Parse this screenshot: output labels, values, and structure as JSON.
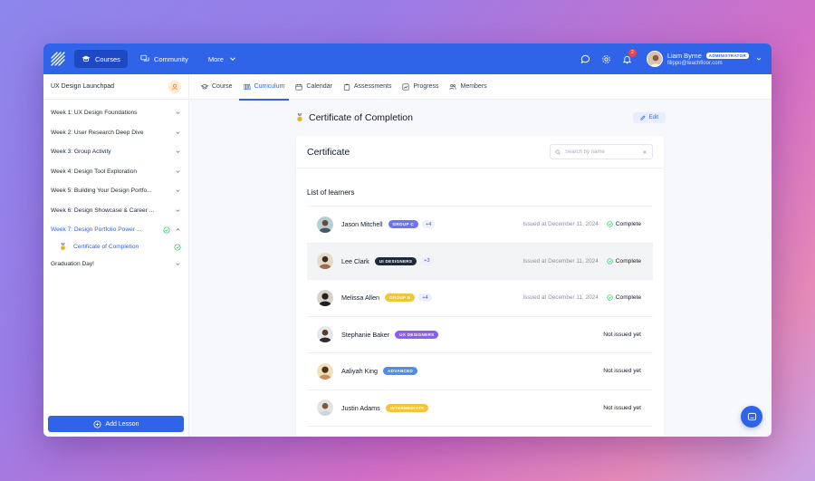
{
  "topbar": {
    "logo_icon": "stripes-logo",
    "nav": [
      {
        "label": "Courses",
        "icon": "graduation-cap-icon"
      },
      {
        "label": "Community",
        "icon": "chat-icon"
      },
      {
        "label": "More",
        "icon": "chevron-down-icon"
      }
    ],
    "notification_count": "2",
    "user": {
      "name": "Liam Byrne",
      "role": "ADMINISTRATOR",
      "email": "filippo@teachfloor.com"
    }
  },
  "sidebar": {
    "course_title": "UX Design Launchpad",
    "weeks": [
      {
        "label": "Week 1: UX Design Foundations"
      },
      {
        "label": "Week 2: User Research Deep Dive"
      },
      {
        "label": "Week 3: Group Activity"
      },
      {
        "label": "Week 4: Design Tool Exploration"
      },
      {
        "label": "Week 5: Building Your Design Portfo..."
      },
      {
        "label": "Week 6: Design Showcase & Career ..."
      },
      {
        "label": "Week 7: Design Portfolio Power ..."
      },
      {
        "label": "Graduation Day!"
      }
    ],
    "sub_item": "Certificate of Completion",
    "add_lesson": "Add Lesson"
  },
  "tabs": [
    "Course",
    "Curriculum",
    "Calendar",
    "Assessments",
    "Progress",
    "Members"
  ],
  "main": {
    "lesson_title": "Certificate of Completion",
    "edit_label": "Edit",
    "card_title": "Certificate",
    "search_placeholder": "Search by name",
    "list_label": "List of learners",
    "learners": [
      {
        "name": "Jason Mitchell",
        "tag": "GROUP C",
        "tag_color": "#6d74f0",
        "more": "+4",
        "issued": "Issued at December 11, 2024",
        "status": "Complete"
      },
      {
        "name": "Lee Clark",
        "tag": "UI DESIGNERS",
        "tag_color": "#1f2937",
        "more": "+3",
        "issued": "Issued at December 11, 2024",
        "status": "Complete"
      },
      {
        "name": "Melissa Allen",
        "tag": "GROUP B",
        "tag_color": "#f2c53d",
        "more": "+4",
        "issued": "Issued at December 11, 2024",
        "status": "Complete"
      },
      {
        "name": "Stephanie Baker",
        "tag": "UX DESIGNERS",
        "tag_color": "#8b5cf6",
        "more": "",
        "issued": "",
        "status": "Not issued yet"
      },
      {
        "name": "Aaliyah King",
        "tag": "ADVANCED",
        "tag_color": "#4f8de8",
        "more": "",
        "issued": "",
        "status": "Not issued yet"
      },
      {
        "name": "Justin Adams",
        "tag": "INTERMEDIATE",
        "tag_color": "#f2c53d",
        "more": "",
        "issued": "",
        "status": "Not issued yet"
      }
    ]
  },
  "colors": {
    "primary": "#2f63e8",
    "complete": "#22c55e"
  }
}
